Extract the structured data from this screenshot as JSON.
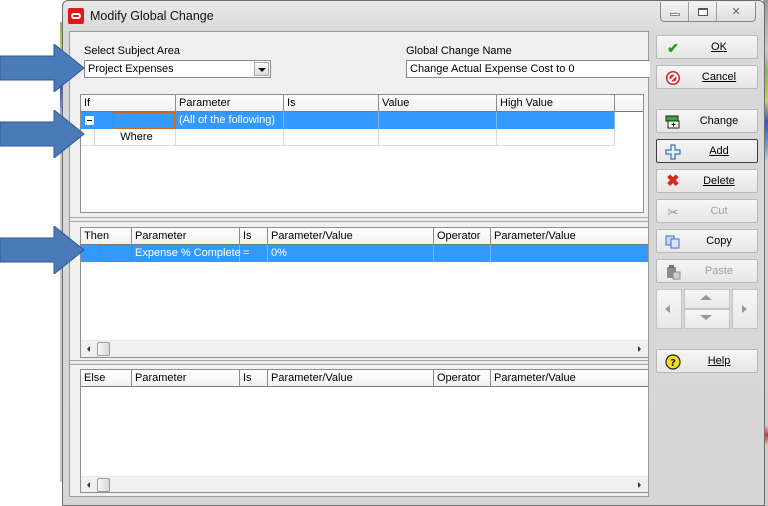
{
  "window": {
    "title": "Modify Global Change",
    "controls": {
      "minimize": "minimize",
      "maximize": "maximize",
      "close": "✕"
    }
  },
  "subject_area": {
    "label": "Select Subject Area",
    "selected": "Project Expenses"
  },
  "global_change_name": {
    "label": "Global Change Name",
    "value": "Change Actual Expense Cost to 0"
  },
  "if_grid": {
    "headers": [
      "If",
      "Parameter",
      "Is",
      "Value",
      "High Value"
    ],
    "rows": [
      {
        "selected": true,
        "expander": "collapse",
        "if": "",
        "parameter": "(All of the following)",
        "is": "",
        "value": "",
        "high_value": ""
      },
      {
        "selected": false,
        "if": "Where",
        "parameter": "",
        "is": "",
        "value": "",
        "high_value": ""
      }
    ]
  },
  "then_grid": {
    "headers": [
      "Then",
      "Parameter",
      "Is",
      "Parameter/Value",
      "Operator",
      "Parameter/Value"
    ],
    "rows": [
      {
        "selected": true,
        "then": "",
        "parameter": "Expense % Complete",
        "is": "=",
        "parameter_value": "0%",
        "operator": "",
        "parameter_value_2": ""
      }
    ]
  },
  "else_grid": {
    "headers": [
      "Else",
      "Parameter",
      "Is",
      "Parameter/Value",
      "Operator",
      "Parameter/Value"
    ],
    "rows": []
  },
  "buttons": {
    "ok": {
      "label": "OK",
      "icon": "checkmark-icon"
    },
    "cancel": {
      "label": "Cancel",
      "icon": "cancel-icon"
    },
    "change": {
      "label": "Change",
      "icon": "change-icon"
    },
    "add": {
      "label": "Add",
      "icon": "plus-icon"
    },
    "delete": {
      "label": "Delete",
      "icon": "x-icon"
    },
    "cut": {
      "label": "Cut",
      "icon": "scissors-icon",
      "disabled": true
    },
    "copy": {
      "label": "Copy",
      "icon": "copy-icon"
    },
    "paste": {
      "label": "Paste",
      "icon": "paste-icon",
      "disabled": true
    },
    "help": {
      "label": "Help",
      "icon": "help-icon"
    }
  },
  "colors": {
    "selection": "#3399ff",
    "focus_border": "#d06a10",
    "annotation_arrow": "#4a7ab8"
  }
}
